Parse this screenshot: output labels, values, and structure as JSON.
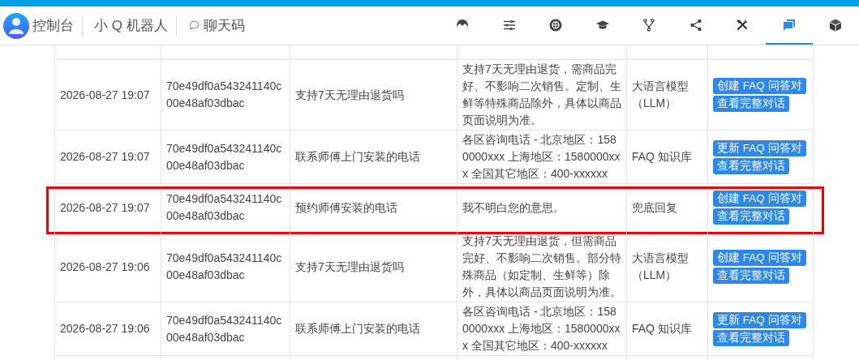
{
  "nav": {
    "brand": "控制台",
    "links": [
      {
        "label": "小 Q 机器人",
        "icon": false
      },
      {
        "label": "聊天码",
        "icon": true
      }
    ],
    "toolbar": [
      {
        "selected": false
      },
      {
        "selected": false
      },
      {
        "selected": false
      },
      {
        "selected": false
      },
      {
        "selected": false
      },
      {
        "selected": false
      },
      {
        "selected": false
      },
      {
        "selected": true
      },
      {
        "selected": false
      }
    ]
  },
  "table": {
    "rows": [
      {
        "time": "2026-08-27 19:07",
        "id": "70e49df0a543241140c00e48af03dbac",
        "question": "支持7天无理由退货吗",
        "answer": "支持7天无理由退货，需商品完好、不影响二次销售。定制、生鲜等特殊商品除外，具体以商品页面说明为准。",
        "source": "大语言模型（LLM）",
        "actions": [
          "创建 FAQ 问答对",
          "查看完整对话"
        ],
        "highlighted": false
      },
      {
        "time": "2026-08-27 19:07",
        "id": "70e49df0a543241140c00e48af03dbac",
        "question": "联系师傅上门安装的电话",
        "answer": "各区咨询电话 - 北京地区：1580000xxx 上海地区：1580000xxx 全国其它地区：400-xxxxxx",
        "source": "FAQ 知识库",
        "actions": [
          "更新 FAQ 问答对",
          "查看完整对话"
        ],
        "highlighted": false
      },
      {
        "time": "2026-08-27 19:07",
        "id": "70e49df0a543241140c00e48af03dbac",
        "question": "预约师傅安装的电话",
        "answer": "我不明白您的意思。",
        "source": "兜底回复",
        "actions": [
          "创建 FAQ 问答对",
          "查看完整对话"
        ],
        "highlighted": true
      },
      {
        "time": "2026-08-27 19:06",
        "id": "70e49df0a543241140c00e48af03dbac",
        "question": "支持7天无理由退货吗",
        "answer": "支持7天无理由退货，但需商品完好、不影响二次销售。部分特殊商品（如定制、生鲜等）除外，具体以商品页面说明为准。",
        "source": "大语言模型（LLM）",
        "actions": [
          "创建 FAQ 问答对",
          "查看完整对话"
        ],
        "highlighted": false
      },
      {
        "time": "2026-08-27 19:06",
        "id": "70e49df0a543241140c00e48af03dbac",
        "question": "联系师傅上门安装的电话",
        "answer": "各区咨询电话 - 北京地区：1580000xxx 上海地区：1580000xxx 全国其它地区：400-xxxxxx",
        "source": "FAQ 知识库",
        "actions": [
          "更新 FAQ 问答对",
          "查看完整对话"
        ],
        "highlighted": false
      }
    ]
  }
}
